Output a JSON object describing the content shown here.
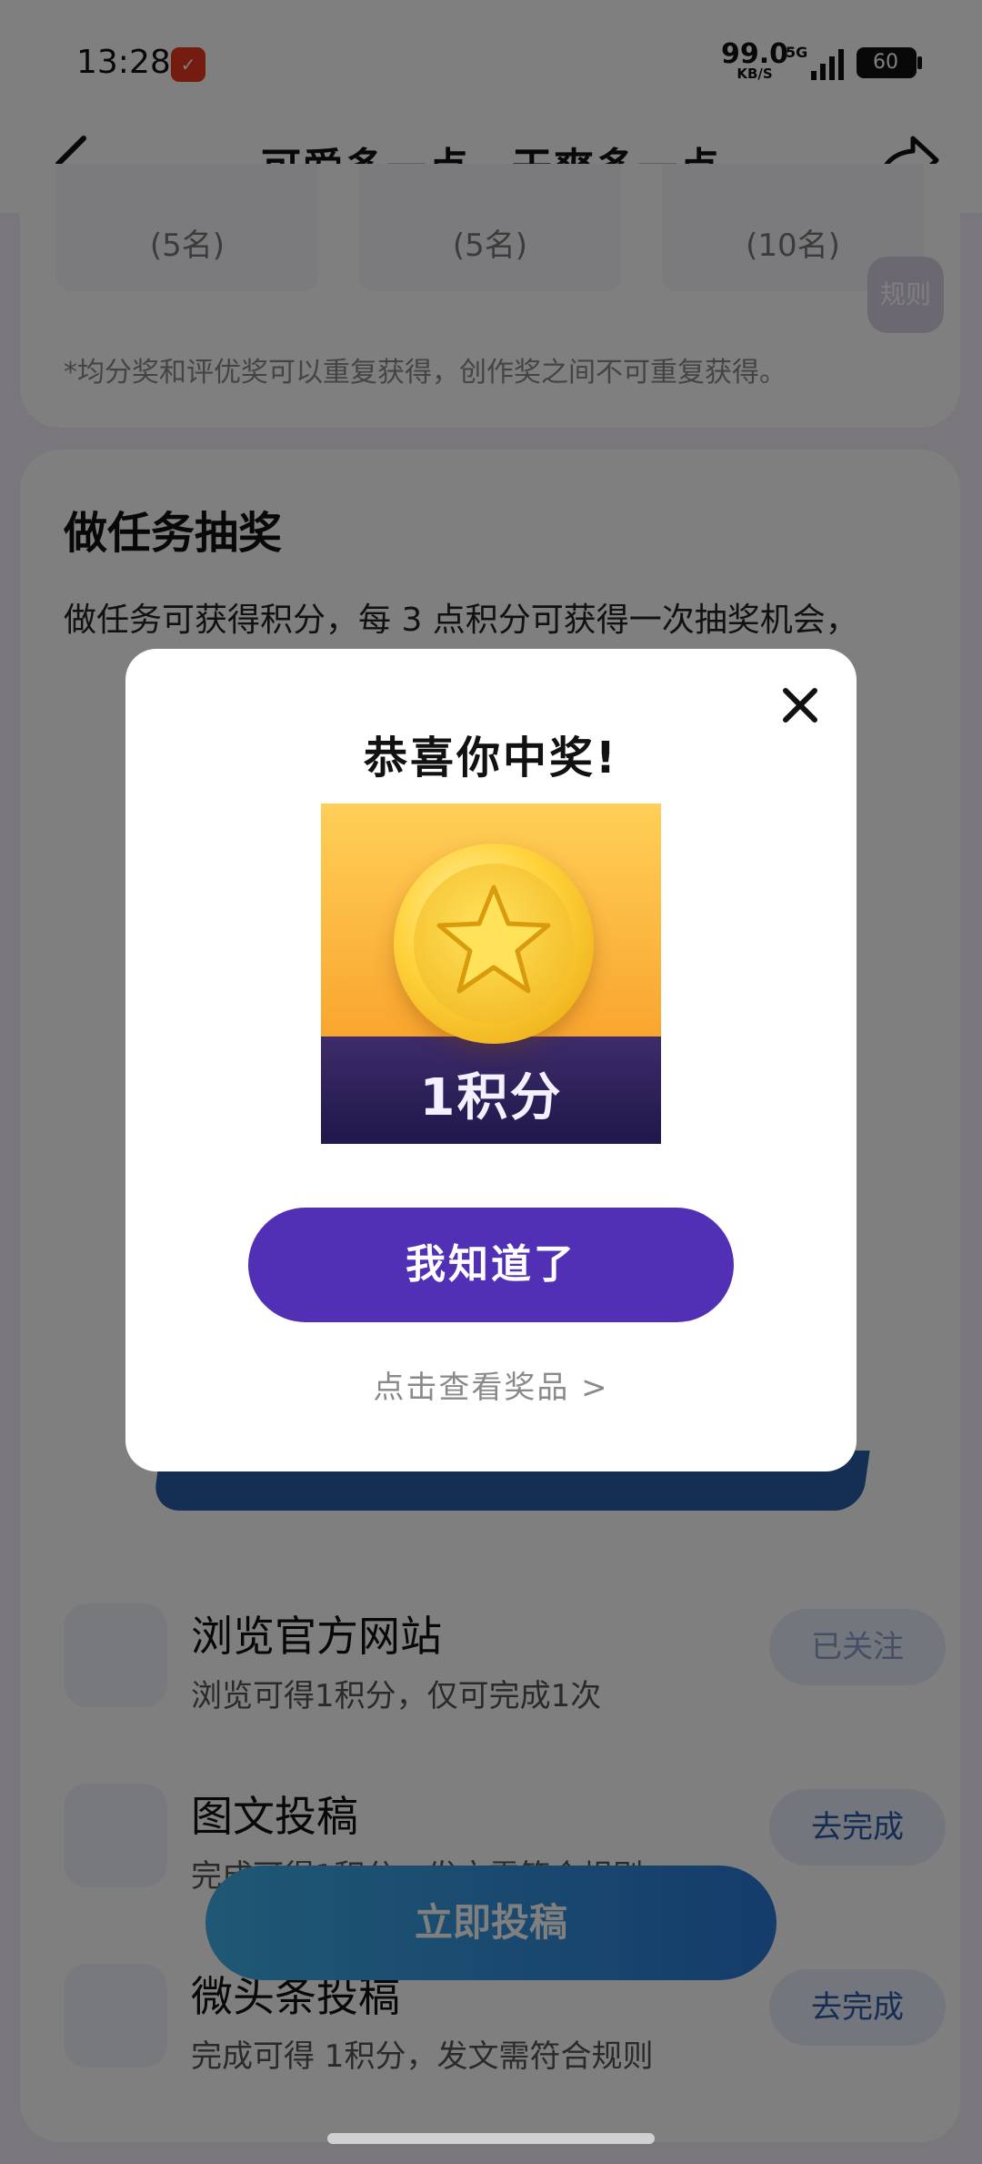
{
  "status_bar": {
    "time": "13:28",
    "app_icon": "app-notification-icon",
    "net_speed": "99.0",
    "net_speed_unit": "KB/S",
    "network": "5G",
    "battery": "60"
  },
  "header": {
    "title": "可爱多一点，干爽多一点",
    "back_icon": "back-arrow-icon",
    "share_icon": "share-icon"
  },
  "prize_section": {
    "boxes": [
      {
        "count": "(5名)"
      },
      {
        "count": "(5名)"
      },
      {
        "count": "(10名)"
      }
    ],
    "rules_label": "规则",
    "note": "*均分奖和评优奖可以重复获得，创作奖之间不可重复获得。"
  },
  "task_section": {
    "heading": "做任务抽奖",
    "desc": "做任务可获得积分，每 3 点积分可获得一次抽奖机会，",
    "tasks": [
      {
        "title": "浏览官方网站",
        "subtitle": "浏览可得1积分，仅可完成1次",
        "button": "已关注",
        "icon": "website-icon"
      },
      {
        "title": "图文投稿",
        "subtitle": "完成可得1积分，发文需符合规则",
        "button": "去完成",
        "icon": "image-post-icon"
      },
      {
        "title": "微头条投稿",
        "subtitle": "完成可得 1积分，发文需符合规则",
        "button": "去完成",
        "icon": "micro-post-icon"
      }
    ],
    "submit_button": "立即投稿"
  },
  "modal": {
    "title": "恭喜你中奖!",
    "prize_label": "1积分",
    "prize_icon": "gold-star-coin-icon",
    "confirm_button": "我知道了",
    "view_prizes_link": "点击查看奖品 >",
    "close_icon": "close-icon"
  },
  "colors": {
    "primary_button": "#5130b6",
    "submit_button": "#2a78d6",
    "coin_gold": "#ffd23b",
    "prize_banner": "#20174a"
  }
}
